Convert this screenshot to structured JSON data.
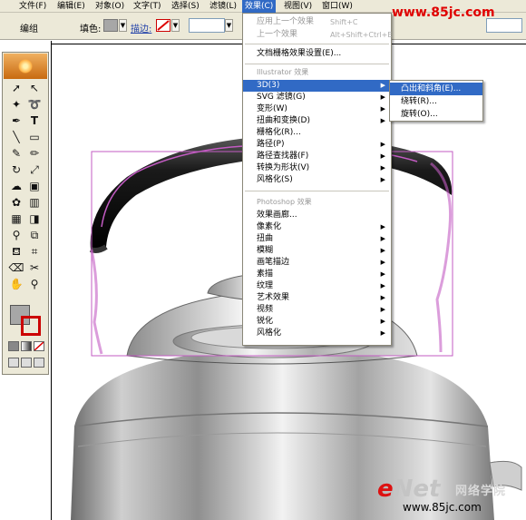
{
  "menubar": {
    "items": [
      "文件(F)",
      "编辑(E)",
      "对象(O)",
      "文字(T)",
      "选择(S)",
      "滤镜(L)",
      "效果(C)",
      "视图(V)",
      "窗口(W)"
    ],
    "active_index": 6
  },
  "control_bar": {
    "group_label": "编组",
    "fill_label": "填色:",
    "stroke_label": "描边:"
  },
  "watermark_top": "www.85jc.com",
  "effect_menu": {
    "apply_last": "应用上一个效果",
    "apply_last_shortcut": "Shift+C",
    "last_effect": "上一个效果",
    "last_effect_shortcut": "Alt+Shift+Ctrl+E",
    "raster_settings": "文档栅格效果设置(E)...",
    "illustrator_header": "Illustrator 效果",
    "illustrator_items": [
      {
        "label": "3D(3)",
        "submenu": true
      },
      {
        "label": "SVG 滤镜(G)",
        "submenu": true
      },
      {
        "label": "变形(W)",
        "submenu": true
      },
      {
        "label": "扭曲和变换(D)",
        "submenu": true
      },
      {
        "label": "栅格化(R)...",
        "submenu": false
      },
      {
        "label": "路径(P)",
        "submenu": true
      },
      {
        "label": "路径查找器(F)",
        "submenu": true
      },
      {
        "label": "转换为形状(V)",
        "submenu": true
      },
      {
        "label": "风格化(S)",
        "submenu": true
      }
    ],
    "photoshop_header": "Photoshop 效果",
    "photoshop_items": [
      {
        "label": "效果画廊...",
        "submenu": false
      },
      {
        "label": "像素化",
        "submenu": true
      },
      {
        "label": "扭曲",
        "submenu": true
      },
      {
        "label": "模糊",
        "submenu": true
      },
      {
        "label": "画笔描边",
        "submenu": true
      },
      {
        "label": "素描",
        "submenu": true
      },
      {
        "label": "纹理",
        "submenu": true
      },
      {
        "label": "艺术效果",
        "submenu": true
      },
      {
        "label": "视频",
        "submenu": true
      },
      {
        "label": "锐化",
        "submenu": true
      },
      {
        "label": "风格化",
        "submenu": true
      }
    ]
  },
  "submenu_3d": {
    "items": [
      "凸出和斜角(E)...",
      "绕转(R)...",
      "旋转(O)..."
    ],
    "selected_index": 0
  },
  "brand": {
    "enet_e": "e",
    "enet_rest": "Net",
    "cn": "网络学院"
  },
  "watermark_bottom": "www.85jc.com",
  "colors": {
    "menu_highlight": "#316ac5",
    "watermark_red": "#e00000",
    "selection_magenta": "#c35bc3",
    "ui_face": "#ece9d8"
  }
}
